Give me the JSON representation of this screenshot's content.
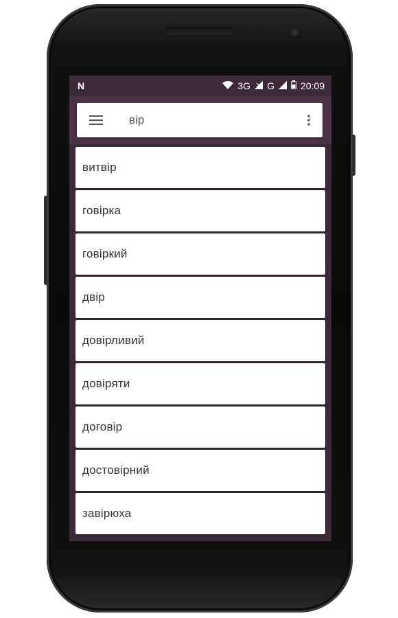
{
  "status_bar": {
    "left_icon": "nfc-icon",
    "network": "3G",
    "network2": "G",
    "time": "20:09",
    "icons": [
      "wifi-icon",
      "signal-icon",
      "signal-icon",
      "battery-icon"
    ]
  },
  "search": {
    "menu_icon": "hamburger-icon",
    "value": "вір",
    "more_icon": "more-vert-icon"
  },
  "results": [
    {
      "label": "витвір"
    },
    {
      "label": "говірка"
    },
    {
      "label": "говіркий"
    },
    {
      "label": "двір"
    },
    {
      "label": "довірливий"
    },
    {
      "label": "довіряти"
    },
    {
      "label": "договір"
    },
    {
      "label": "достовірний"
    },
    {
      "label": "завірюха"
    }
  ],
  "colors": {
    "status_bar": "#3b2a38",
    "app_bar": "#4a3347",
    "card": "#ffffff",
    "text": "#333333"
  }
}
